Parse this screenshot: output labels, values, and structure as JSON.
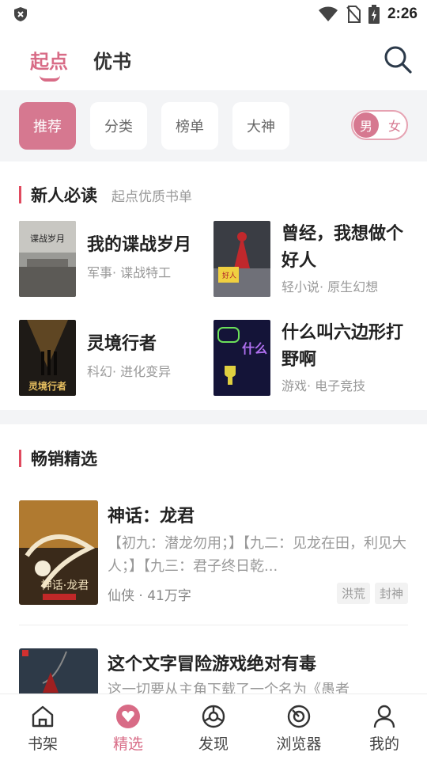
{
  "status_bar": {
    "time": "2:26"
  },
  "top_tabs": [
    {
      "label": "起点",
      "active": true
    },
    {
      "label": "优书",
      "active": false
    }
  ],
  "filters": [
    {
      "label": "推荐",
      "active": true
    },
    {
      "label": "分类",
      "active": false
    },
    {
      "label": "榜单",
      "active": false
    },
    {
      "label": "大神",
      "active": false
    }
  ],
  "gender_toggle": {
    "male": "男",
    "female": "女",
    "selected": "男"
  },
  "new_reader": {
    "title": "新人必读",
    "subtitle": "起点优质书单",
    "books": [
      {
        "title": "我的谍战岁月",
        "tag": "军事· 谍战特工"
      },
      {
        "title": "曾经，我想做个好人",
        "tag": "轻小说· 原生幻想"
      },
      {
        "title": "灵境行者",
        "tag": "科幻· 进化变异"
      },
      {
        "title": "什么叫六边形打野啊",
        "tag": "游戏· 电子竞技"
      }
    ]
  },
  "bestsellers": {
    "title": "畅销精选",
    "books": [
      {
        "title": "神话：龙君",
        "desc": "【初九：潜龙勿用；】【九二：见龙在田，利见大人；】【九三：君子终日乾...",
        "meta": "仙侠 · 41万字",
        "tags": [
          "洪荒",
          "封神"
        ]
      },
      {
        "title": "这个文字冒险游戏绝对有毒",
        "desc": "这一切要从主角下载了一个名为《愚者"
      }
    ]
  },
  "bottom_nav": [
    {
      "label": "书架",
      "icon": "bookshelf-icon",
      "active": false
    },
    {
      "label": "精选",
      "icon": "featured-icon",
      "active": true
    },
    {
      "label": "发现",
      "icon": "discover-icon",
      "active": false
    },
    {
      "label": "浏览器",
      "icon": "browser-icon",
      "active": false
    },
    {
      "label": "我的",
      "icon": "profile-icon",
      "active": false
    }
  ],
  "colors": {
    "accent": "#d86b86",
    "section_bar": "#e04a5f"
  }
}
